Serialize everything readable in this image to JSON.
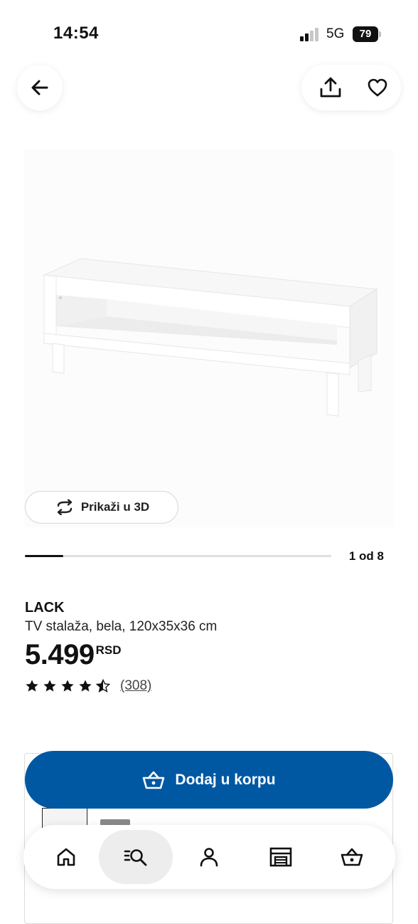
{
  "status_bar": {
    "time": "14:54",
    "network": "5G",
    "battery": "79"
  },
  "header": {
    "back_icon": "arrow-left-icon",
    "share_icon": "share-icon",
    "favorite_icon": "heart-icon"
  },
  "gallery": {
    "view_3d_label": "Prikaži u 3D",
    "view_3d_icon": "rotate-3d-icon",
    "position_text": "1 od 8",
    "progress_fraction": 0.125
  },
  "product": {
    "name": "LACK",
    "description": "TV stalaža, bela, 120x35x36 cm",
    "price": "5.499",
    "currency": "RSD",
    "rating_value": 4.5,
    "rating_max": 5,
    "review_count": "(308)"
  },
  "cta": {
    "add_to_cart_label": "Dodaj u korpu",
    "icon": "basket-icon",
    "color": "#0058a3"
  },
  "bottom_nav": {
    "items": [
      {
        "icon": "home-icon",
        "active": false
      },
      {
        "icon": "search-list-icon",
        "active": true
      },
      {
        "icon": "user-icon",
        "active": false
      },
      {
        "icon": "store-icon",
        "active": false
      },
      {
        "icon": "basket-icon",
        "active": false
      }
    ]
  }
}
